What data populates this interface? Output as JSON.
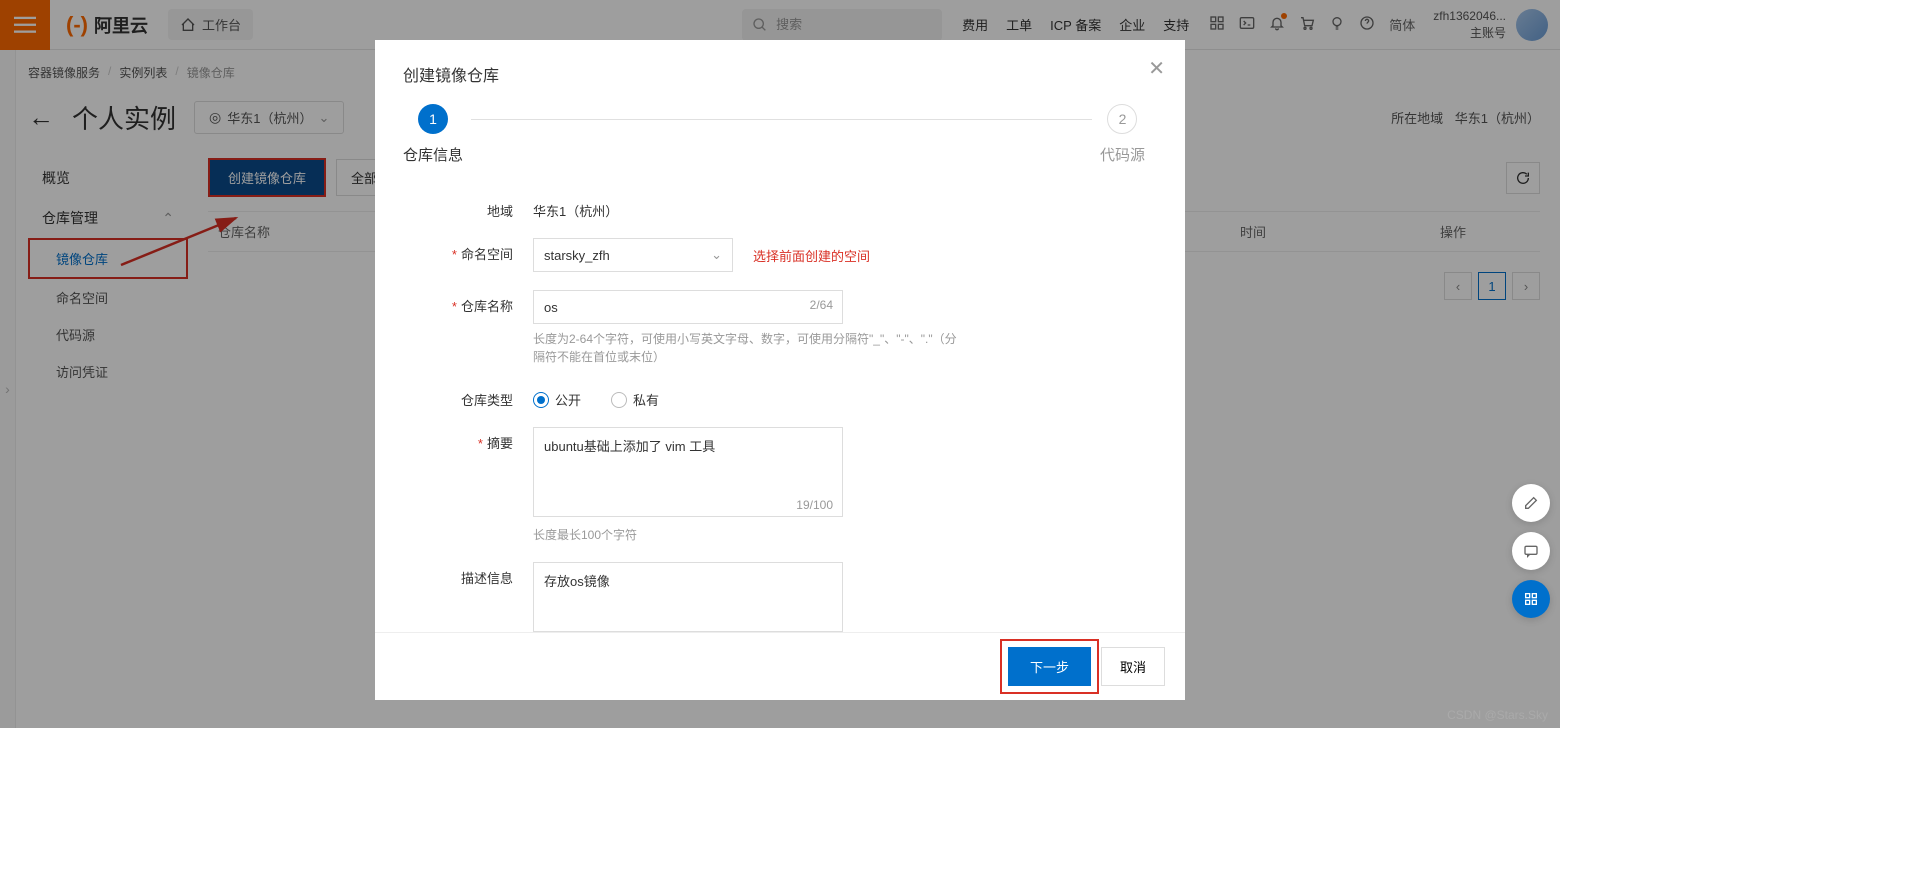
{
  "header": {
    "logo_text": "阿里云",
    "workspace": "工作台",
    "search_placeholder": "搜索",
    "links": [
      "费用",
      "工单",
      "ICP 备案",
      "企业",
      "支持"
    ],
    "lang": "简体",
    "user_name": "zfh1362046...",
    "user_role": "主账号"
  },
  "breadcrumb": {
    "items": [
      "容器镜像服务",
      "实例列表",
      "镜像仓库"
    ]
  },
  "page": {
    "title": "个人实例",
    "region_selector": "华东1（杭州）",
    "region_label": "所在地域",
    "region_value": "华东1（杭州）"
  },
  "nav": {
    "overview": "概览",
    "repo_mgmt": "仓库管理",
    "subs": [
      "镜像仓库",
      "命名空间",
      "代码源",
      "访问凭证"
    ]
  },
  "toolbar": {
    "create": "创建镜像仓库",
    "all_ns": "全部命…"
  },
  "table": {
    "col_name": "仓库名称",
    "col_time": "时间",
    "col_op": "操作"
  },
  "pagination": {
    "current": "1"
  },
  "modal": {
    "title": "创建镜像仓库",
    "step1": "仓库信息",
    "step2": "代码源",
    "labels": {
      "region": "地域",
      "namespace": "命名空间",
      "repo_name": "仓库名称",
      "repo_type": "仓库类型",
      "summary": "摘要",
      "description": "描述信息"
    },
    "values": {
      "region": "华东1（杭州）",
      "namespace": "starsky_zfh",
      "repo_name": "os",
      "repo_name_count": "2/64",
      "repo_name_hint": "长度为2-64个字符，可使用小写英文字母、数字，可使用分隔符\"_\"、\"-\"、\".\"（分隔符不能在首位或末位）",
      "summary": "ubuntu基础上添加了 vim 工具",
      "summary_count": "19/100",
      "summary_hint": "长度最长100个字符",
      "description": "存放os镜像"
    },
    "radio_public": "公开",
    "radio_private": "私有",
    "annotation": "选择前面创建的空间",
    "btn_next": "下一步",
    "btn_cancel": "取消"
  },
  "watermark": "CSDN @Stars.Sky"
}
